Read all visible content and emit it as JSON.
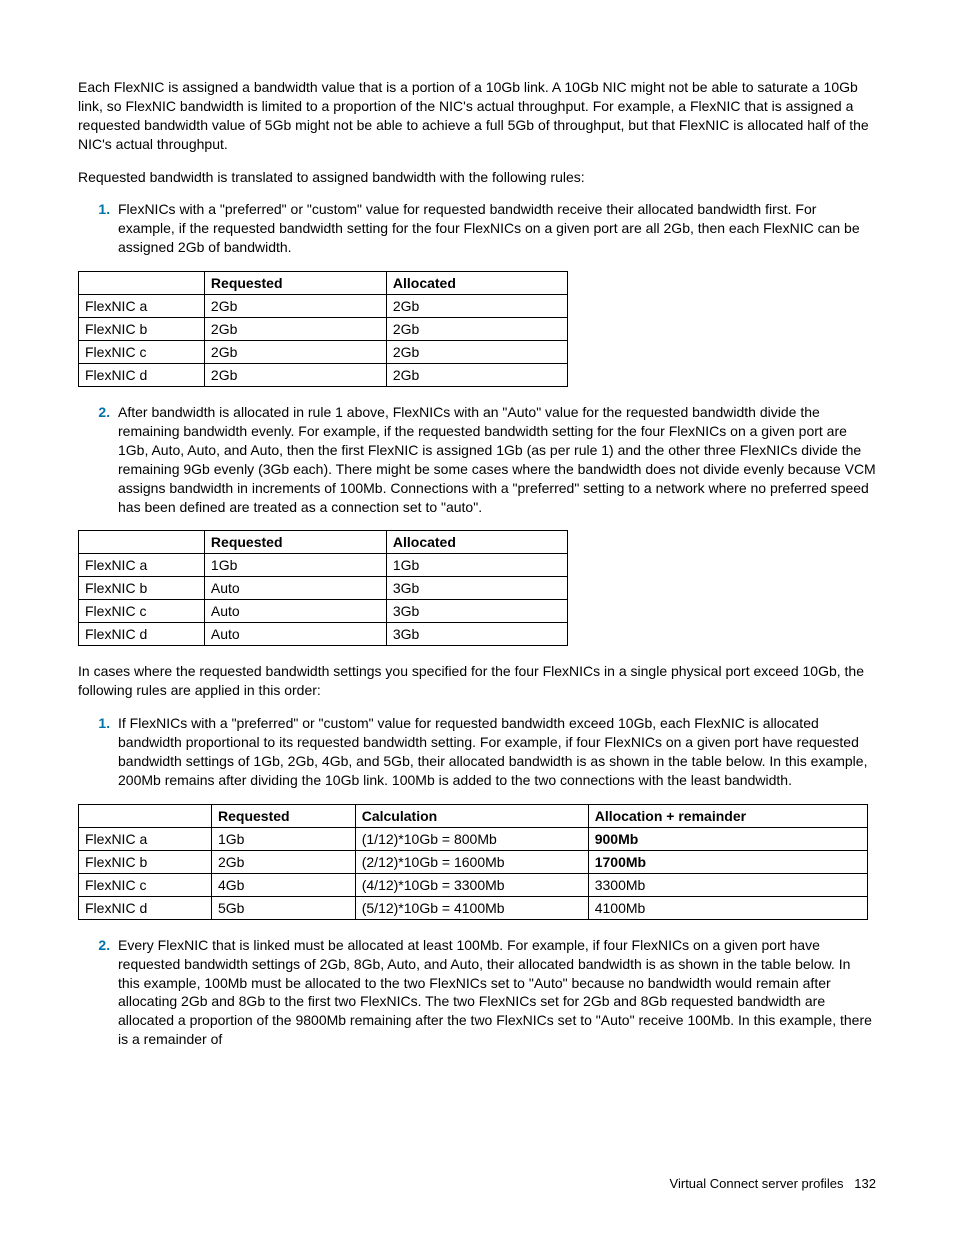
{
  "paragraphs": {
    "intro": "Each FlexNIC is assigned a bandwidth value that is a portion of a 10Gb link. A 10Gb NIC might not be able to saturate a 10Gb link, so FlexNIC bandwidth is limited to a proportion of the NIC's actual throughput. For example, a FlexNIC that is assigned a requested bandwidth value of 5Gb might not be able to achieve a full 5Gb of throughput, but that FlexNIC is allocated half of the NIC's actual throughput.",
    "rules_intro": "Requested bandwidth is translated to assigned bandwidth with the following rules:",
    "exceed_intro": "In cases where the requested bandwidth settings you specified for the four FlexNICs in a single physical port exceed 10Gb, the following rules are applied in this order:"
  },
  "list1": {
    "item1": "FlexNICs with a \"preferred\" or \"custom\" value for requested bandwidth receive their allocated bandwidth first. For example, if the requested bandwidth setting for the four FlexNICs on a given port are all 2Gb, then each FlexNIC can be assigned 2Gb of bandwidth.",
    "item2": "After bandwidth is allocated in rule 1 above, FlexNICs with an \"Auto\" value for the requested bandwidth divide the remaining bandwidth evenly. For example, if the requested bandwidth setting for the four FlexNICs on a given port are 1Gb, Auto, Auto, and Auto, then the first FlexNIC is assigned 1Gb (as per rule 1) and the other three FlexNICs divide the remaining 9Gb evenly (3Gb each). There might be some cases where the bandwidth does not divide evenly because VCM assigns bandwidth in increments of 100Mb. Connections with a \"preferred\" setting to a network where no preferred speed has been defined are treated as a connection set to \"auto\"."
  },
  "list2": {
    "item1": "If FlexNICs with a \"preferred\" or \"custom\" value for requested bandwidth exceed 10Gb, each FlexNIC is allocated bandwidth proportional to its requested bandwidth setting. For example, if four FlexNICs on a given port have requested bandwidth settings of 1Gb, 2Gb, 4Gb, and 5Gb, their allocated bandwidth is as shown in the table below. In this example, 200Mb remains after dividing the 10Gb link. 100Mb is added to the two connections with the least bandwidth.",
    "item2": "Every FlexNIC that is linked must be allocated at least 100Mb. For example, if four FlexNICs on a given port have requested bandwidth settings of 2Gb, 8Gb, Auto, and Auto, their allocated bandwidth is as shown in the table below. In this example, 100Mb must be allocated to the two FlexNICs set to \"Auto\" because no bandwidth would remain after allocating 2Gb and 8Gb to the first two FlexNICs. The two FlexNICs set for 2Gb and 8Gb requested bandwidth are allocated a proportion of the 9800Mb remaining after the two FlexNICs set to \"Auto\" receive 100Mb. In this example, there is a remainder of"
  },
  "table1": {
    "headers": {
      "c0": "",
      "c1": "Requested",
      "c2": "Allocated"
    },
    "rows": [
      {
        "c0": "FlexNIC a",
        "c1": "2Gb",
        "c2": "2Gb"
      },
      {
        "c0": "FlexNIC b",
        "c1": "2Gb",
        "c2": "2Gb"
      },
      {
        "c0": "FlexNIC c",
        "c1": "2Gb",
        "c2": "2Gb"
      },
      {
        "c0": "FlexNIC d",
        "c1": "2Gb",
        "c2": "2Gb"
      }
    ]
  },
  "table2": {
    "headers": {
      "c0": "",
      "c1": "Requested",
      "c2": "Allocated"
    },
    "rows": [
      {
        "c0": "FlexNIC a",
        "c1": "1Gb",
        "c2": "1Gb"
      },
      {
        "c0": "FlexNIC b",
        "c1": "Auto",
        "c2": "3Gb"
      },
      {
        "c0": "FlexNIC c",
        "c1": "Auto",
        "c2": "3Gb"
      },
      {
        "c0": "FlexNIC d",
        "c1": "Auto",
        "c2": "3Gb"
      }
    ]
  },
  "table3": {
    "headers": {
      "c0": "",
      "c1": "Requested",
      "c2": "Calculation",
      "c3": "Allocation + remainder"
    },
    "rows": [
      {
        "c0": "FlexNIC a",
        "c1": "1Gb",
        "c2": "(1/12)*10Gb = 800Mb",
        "c3": "900Mb",
        "bold": true
      },
      {
        "c0": "FlexNIC b",
        "c1": "2Gb",
        "c2": "(2/12)*10Gb = 1600Mb",
        "c3": "1700Mb",
        "bold": true
      },
      {
        "c0": "FlexNIC c",
        "c1": "4Gb",
        "c2": "(4/12)*10Gb = 3300Mb",
        "c3": "3300Mb",
        "bold": false
      },
      {
        "c0": "FlexNIC d",
        "c1": "5Gb",
        "c2": "(5/12)*10Gb = 4100Mb",
        "c3": "4100Mb",
        "bold": false
      }
    ]
  },
  "footer": {
    "section": "Virtual Connect server profiles",
    "page": "132"
  }
}
